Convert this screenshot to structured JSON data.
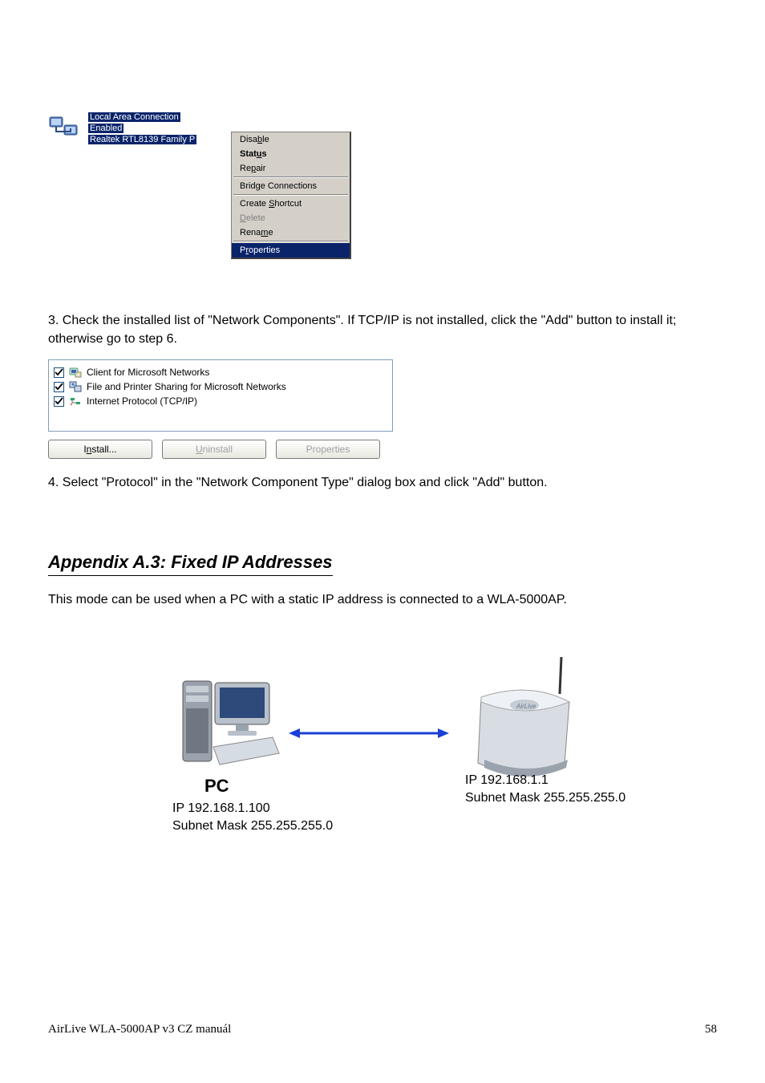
{
  "connection": {
    "title": "Local Area Connection",
    "state": "Enabled",
    "adapter": "Realtek RTL8139 Family P"
  },
  "context_menu": {
    "items": [
      {
        "label_pre": "Disa",
        "u": "b",
        "label_post": "le",
        "kind": "item"
      },
      {
        "label_pre": "Stat",
        "u": "u",
        "label_post": "s",
        "kind": "bold"
      },
      {
        "label_pre": "Re",
        "u": "p",
        "label_post": "air",
        "kind": "item"
      },
      {
        "kind": "sep"
      },
      {
        "label_pre": "Brid",
        "u": "g",
        "label_post": "e Connections",
        "kind": "item"
      },
      {
        "kind": "sep"
      },
      {
        "label_pre": "Create ",
        "u": "S",
        "label_post": "hortcut",
        "kind": "item"
      },
      {
        "label_pre": "",
        "u": "D",
        "label_post": "elete",
        "kind": "disabled"
      },
      {
        "label_pre": "Rena",
        "u": "m",
        "label_post": "e",
        "kind": "item"
      },
      {
        "kind": "sep"
      },
      {
        "label_pre": "P",
        "u": "r",
        "label_post": "operties",
        "kind": "selected"
      }
    ]
  },
  "step3_text": "3. Check the installed list of \"Network Components\". If TCP/IP is not installed, click the \"Add\" button to install it; otherwise go to step 6.",
  "network_components": {
    "items": [
      {
        "label": "Client for Microsoft Networks",
        "icon": "client"
      },
      {
        "label": "File and Printer Sharing for Microsoft Networks",
        "icon": "share"
      },
      {
        "label": "Internet Protocol (TCP/IP)",
        "icon": "protocol"
      }
    ],
    "install": "Install...",
    "install_u": "n",
    "uninstall": "Uninstall",
    "uninstall_u": "U",
    "properties": "Properties"
  },
  "step4_text": "4. Select \"Protocol\" in the \"Network Component Type\" dialog box and click \"Add\" button.",
  "section": "Appendix A.3: Fixed IP Addresses",
  "section_body": "This mode can be used when a PC with a static IP address is connected to a WLA-5000AP.",
  "diagram": {
    "pc_label": "PC",
    "pc_ip": "IP   192.168.1.100",
    "pc_sub": "Subnet Mask 255.255.255.0",
    "rt_ip": "IP   192.168.1.1",
    "rt_sub": "Subnet Mask 255.255.255.0"
  },
  "footer": {
    "left": "AirLive WLA-5000AP v3 CZ manuál",
    "right": "58"
  }
}
